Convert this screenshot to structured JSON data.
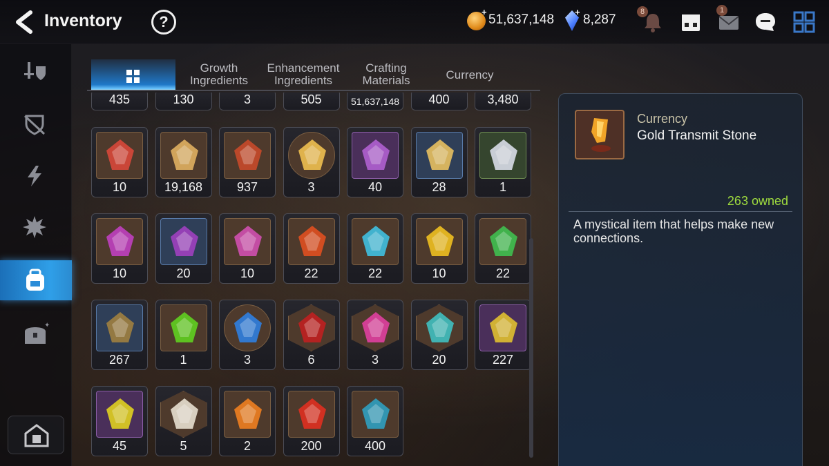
{
  "header": {
    "title": "Inventory",
    "help": "?",
    "gold": "51,637,148",
    "crystals": "8,287",
    "notifications_badge": "8",
    "mail_badge": "1"
  },
  "tabs": [
    {
      "label": "Growth\nIngredients"
    },
    {
      "label": "Enhancement\nIngredients"
    },
    {
      "label": "Crafting\nMaterials"
    },
    {
      "label": "Currency"
    }
  ],
  "top_row_counts": [
    "435",
    "130",
    "3",
    "505",
    "51,637,148",
    "400",
    "3,480"
  ],
  "items": [
    {
      "count": "10",
      "icon": "banner-icon",
      "frame": ""
    },
    {
      "count": "19,168",
      "icon": "horse-statue-icon",
      "frame": ""
    },
    {
      "count": "937",
      "icon": "flame-leaf-icon",
      "frame": ""
    },
    {
      "count": "3",
      "icon": "phantasma-pet-icon",
      "frame": "round"
    },
    {
      "count": "40",
      "icon": "purple-flower-icon",
      "frame": "purple"
    },
    {
      "count": "28",
      "icon": "gold-flower-icon",
      "frame": "blue"
    },
    {
      "count": "1",
      "icon": "silver-flower-icon",
      "frame": "green"
    },
    {
      "count": "10",
      "icon": "moon-pentagon-icon",
      "frame": ""
    },
    {
      "count": "20",
      "icon": "moon-triangle-icon",
      "frame": "blue"
    },
    {
      "count": "10",
      "icon": "moon-oval-icon",
      "frame": ""
    },
    {
      "count": "22",
      "icon": "fire-rune-icon",
      "frame": ""
    },
    {
      "count": "22",
      "icon": "ice-rune-icon",
      "frame": ""
    },
    {
      "count": "10",
      "icon": "light-rune-icon",
      "frame": ""
    },
    {
      "count": "22",
      "icon": "earth-rune-icon",
      "frame": ""
    },
    {
      "count": "267",
      "icon": "feather-icon",
      "frame": "blue"
    },
    {
      "count": "1",
      "icon": "green-potion-icon",
      "frame": ""
    },
    {
      "count": "3",
      "icon": "blue-sigil-icon",
      "frame": "round"
    },
    {
      "count": "6",
      "icon": "red-gem-icon",
      "frame": "hex"
    },
    {
      "count": "3",
      "icon": "pink-potion-icon",
      "frame": "hex"
    },
    {
      "count": "20",
      "icon": "dark-stone-icon",
      "frame": "hex"
    },
    {
      "count": "227",
      "icon": "gold-t-stone-icon",
      "frame": "purple"
    },
    {
      "count": "45",
      "icon": "lightning-stone-icon",
      "frame": "purple"
    },
    {
      "count": "5",
      "icon": "white-stone-icon",
      "frame": "hex"
    },
    {
      "count": "2",
      "icon": "orange-t-stone-icon",
      "frame": ""
    },
    {
      "count": "200",
      "icon": "red-crystal-icon",
      "frame": ""
    },
    {
      "count": "400",
      "icon": "teal-crystal-icon",
      "frame": ""
    }
  ],
  "detail": {
    "category": "Currency",
    "name": "Gold Transmit Stone",
    "owned": "263 owned",
    "description": "A mystical item that helps make new connections."
  },
  "colors": {
    "accent": "#1f78c8",
    "owned_green": "#9fdc3e",
    "category_text": "#c9c3a8"
  }
}
